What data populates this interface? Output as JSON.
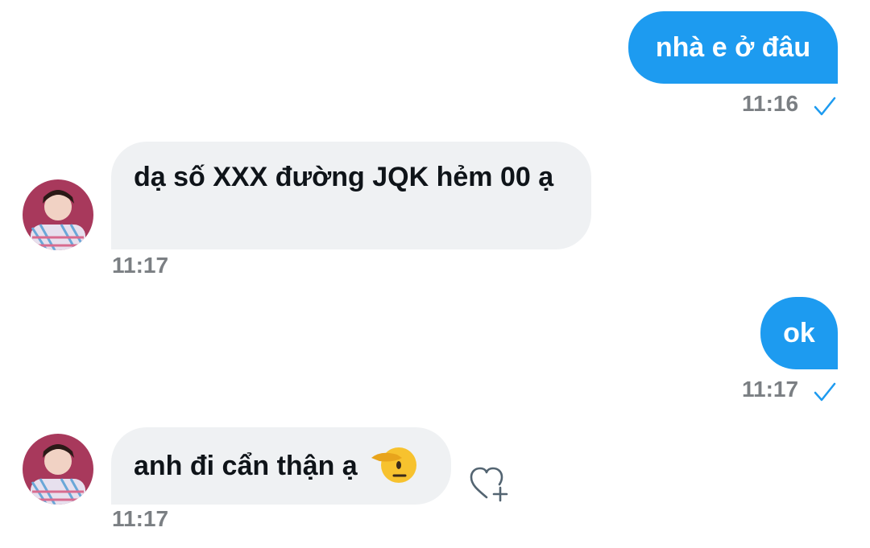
{
  "messages": [
    {
      "direction": "outgoing",
      "text": "nhà e ở đâu",
      "time": "11:16",
      "status": "sent-check-icon"
    },
    {
      "direction": "incoming",
      "text": "dạ số XXX đường JQK hẻm 00 ạ",
      "time": "11:17",
      "avatar": "contact-avatar"
    },
    {
      "direction": "outgoing",
      "text": "ok",
      "time": "11:17",
      "status": "sent-check-icon"
    },
    {
      "direction": "incoming",
      "text": "anh đi cẩn thận ạ",
      "emoji": "saluting-face-icon",
      "time": "11:17",
      "avatar": "contact-avatar",
      "reaction_button": "add-reaction-heart-icon"
    }
  ],
  "colors": {
    "outgoing_bubble": "#1d9bf0",
    "incoming_bubble": "#eff1f3",
    "timestamp": "#7b7f83",
    "check": "#1d9bf0"
  }
}
